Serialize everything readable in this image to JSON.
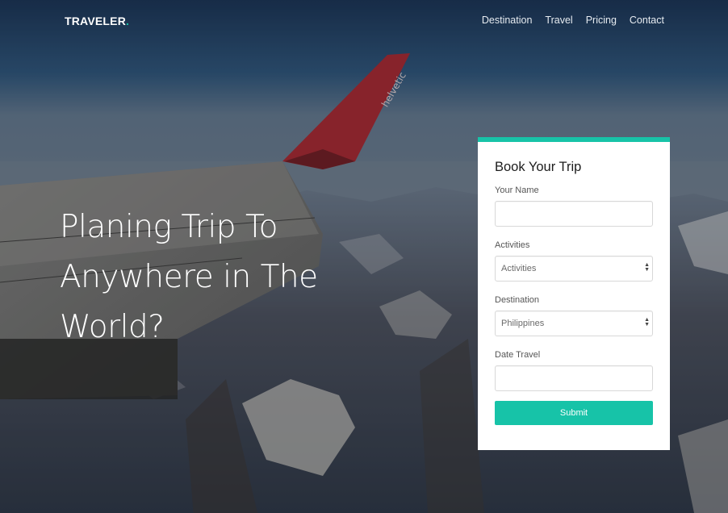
{
  "brand": {
    "name": "TRAVELER",
    "dot": ".",
    "accent_color": "#17c3a8"
  },
  "nav": {
    "items": [
      {
        "label": "Destination"
      },
      {
        "label": "Travel"
      },
      {
        "label": "Pricing"
      },
      {
        "label": "Contact"
      }
    ]
  },
  "hero": {
    "title_lines": [
      "Planing Trip To",
      "Anywhere in The",
      "World?"
    ],
    "background_image": "airplane wing over snowy mountain range",
    "wing_text": "helvetic"
  },
  "booking": {
    "title": "Book Your Trip",
    "fields": [
      {
        "label": "Your Name",
        "type": "text",
        "value": ""
      },
      {
        "label": "Activities",
        "type": "select",
        "selected": "Activities"
      },
      {
        "label": "Destination",
        "type": "select",
        "selected": "Philippines"
      },
      {
        "label": "Date Travel",
        "type": "text",
        "value": ""
      }
    ],
    "submit_label": "Submit"
  }
}
